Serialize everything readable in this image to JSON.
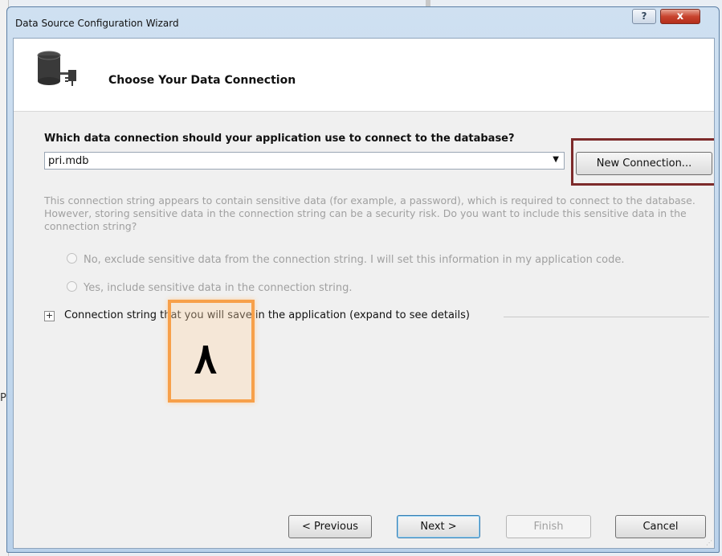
{
  "window": {
    "title": "Data Source Configuration Wizard",
    "help_label": "?",
    "close_label": "x"
  },
  "header": {
    "title": "Choose Your Data Connection",
    "icon": "database-connection-icon"
  },
  "connection": {
    "question": "Which data connection should your application use to connect to the database?",
    "selected": "pri.mdb",
    "new_connection_label": "New Connection..."
  },
  "sensitive": {
    "note": "This connection string appears to contain sensitive data (for example, a password), which is required to connect to the database. However, storing sensitive data in the connection string can be a security risk. Do you want to include this sensitive data in the connection string?",
    "option_no": "No, exclude sensitive data from the connection string. I will set this information in my application code.",
    "option_yes": "Yes, include sensitive data in the connection string."
  },
  "expander": {
    "symbol": "+",
    "label": "Connection string that you will save in the application (expand to see details)"
  },
  "annotation": {
    "number": "٨",
    "highlight_color": "#f7a04a",
    "red_highlight_color": "#7d2b2b"
  },
  "buttons": {
    "previous": "< Previous",
    "next": "Next >",
    "finish": "Finish",
    "cancel": "Cancel"
  },
  "background": {
    "letter": "P"
  }
}
